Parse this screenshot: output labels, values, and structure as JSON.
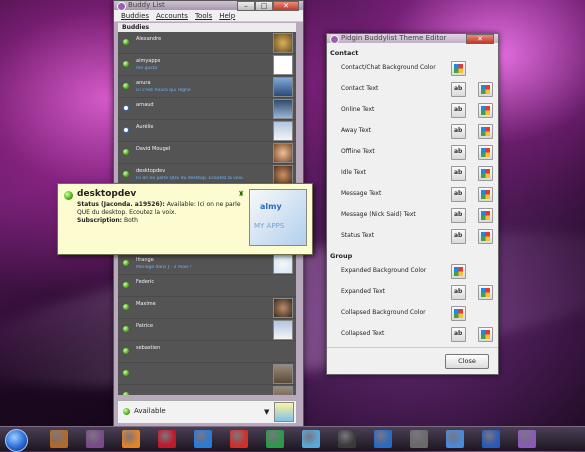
{
  "buddy_window": {
    "title": "Buddy List",
    "menu": [
      "Buddies",
      "Accounts",
      "Tools",
      "Help"
    ],
    "group": "Buddies",
    "rows": [
      {
        "name": "Alexandre",
        "status": "",
        "icon": "available",
        "avatar": "av1"
      },
      {
        "name": "almyapps",
        "status": "me gusta",
        "icon": "available",
        "avatar": "av2"
      },
      {
        "name": "anura",
        "status": "ici c'est Anura qui règne",
        "icon": "available",
        "avatar": "av3"
      },
      {
        "name": "arnaud",
        "status": "",
        "icon": "away",
        "avatar": "av4"
      },
      {
        "name": "Aurélie",
        "status": "",
        "icon": "away",
        "avatar": "av5"
      },
      {
        "name": "David Mougel",
        "status": "",
        "icon": "available",
        "avatar": "av6"
      },
      {
        "name": "desktopdev",
        "status": "Ici on ne parle QUE du desktop. Ecoutez la voix.",
        "icon": "available",
        "avatar": "av7"
      }
    ],
    "rows_lower": [
      {
        "name": "Ifrange",
        "status": "Mariage dans J - 2 mois !",
        "icon": "available",
        "avatar": "av8"
      },
      {
        "name": "Federic",
        "status": "",
        "icon": "available",
        "avatar": ""
      },
      {
        "name": "Maxime",
        "status": "",
        "icon": "available",
        "avatar": "av9"
      },
      {
        "name": "Patrice",
        "status": "",
        "icon": "available",
        "avatar": "av5"
      },
      {
        "name": "sebastien",
        "status": "",
        "icon": "available",
        "avatar": ""
      },
      {
        "name": "",
        "status": "",
        "icon": "available",
        "avatar": "av10"
      },
      {
        "name": "",
        "status": "",
        "icon": "available",
        "avatar": "av10"
      }
    ],
    "status_selector": "Available"
  },
  "tooltip": {
    "name": "desktopdev",
    "status_label": "Status (Jaconda. a19526):",
    "status_text": "Available: Ici on ne parle QUE du desktop. Ecoutez la voix.",
    "subscription_label": "Subscription:",
    "subscription_value": "Both",
    "avatar_brand": "almy",
    "avatar_caption": "MY APPS"
  },
  "theme_editor": {
    "title": "Pidgin Buddylist Theme Editor",
    "sections": [
      {
        "name": "Contact",
        "rows": [
          {
            "label": "Contact/Chat Background Color",
            "buttons": [
              "color"
            ]
          },
          {
            "label": "Contact Text",
            "buttons": [
              "font",
              "color"
            ]
          },
          {
            "label": "Online Text",
            "buttons": [
              "font",
              "color"
            ]
          },
          {
            "label": "Away Text",
            "buttons": [
              "font",
              "color"
            ]
          },
          {
            "label": "Offline Text",
            "buttons": [
              "font",
              "color"
            ]
          },
          {
            "label": "Idle Text",
            "buttons": [
              "font",
              "color"
            ]
          },
          {
            "label": "Message Text",
            "buttons": [
              "font",
              "color"
            ]
          },
          {
            "label": "Message (Nick Said) Text",
            "buttons": [
              "font",
              "color"
            ]
          },
          {
            "label": "Status Text",
            "buttons": [
              "font",
              "color"
            ]
          }
        ]
      },
      {
        "name": "Group",
        "rows": [
          {
            "label": "Expanded Background Color",
            "buttons": [
              "color"
            ]
          },
          {
            "label": "Expanded Text",
            "buttons": [
              "font",
              "color"
            ]
          },
          {
            "label": "Collapsed Background Color",
            "buttons": [
              "color"
            ]
          },
          {
            "label": "Collapsed Text",
            "buttons": [
              "font",
              "color"
            ]
          }
        ]
      }
    ],
    "close_label": "Close"
  },
  "taskbar": {
    "items": [
      "briefcase-icon",
      "screen-icon",
      "firefox-icon",
      "m-icon",
      "ie-icon",
      "chrome-icon",
      "grid-icon",
      "a-icon",
      "window-icon",
      "save-icon",
      "notes-icon",
      "chat-icon",
      "cube-icon",
      "pidgin-icon"
    ]
  }
}
